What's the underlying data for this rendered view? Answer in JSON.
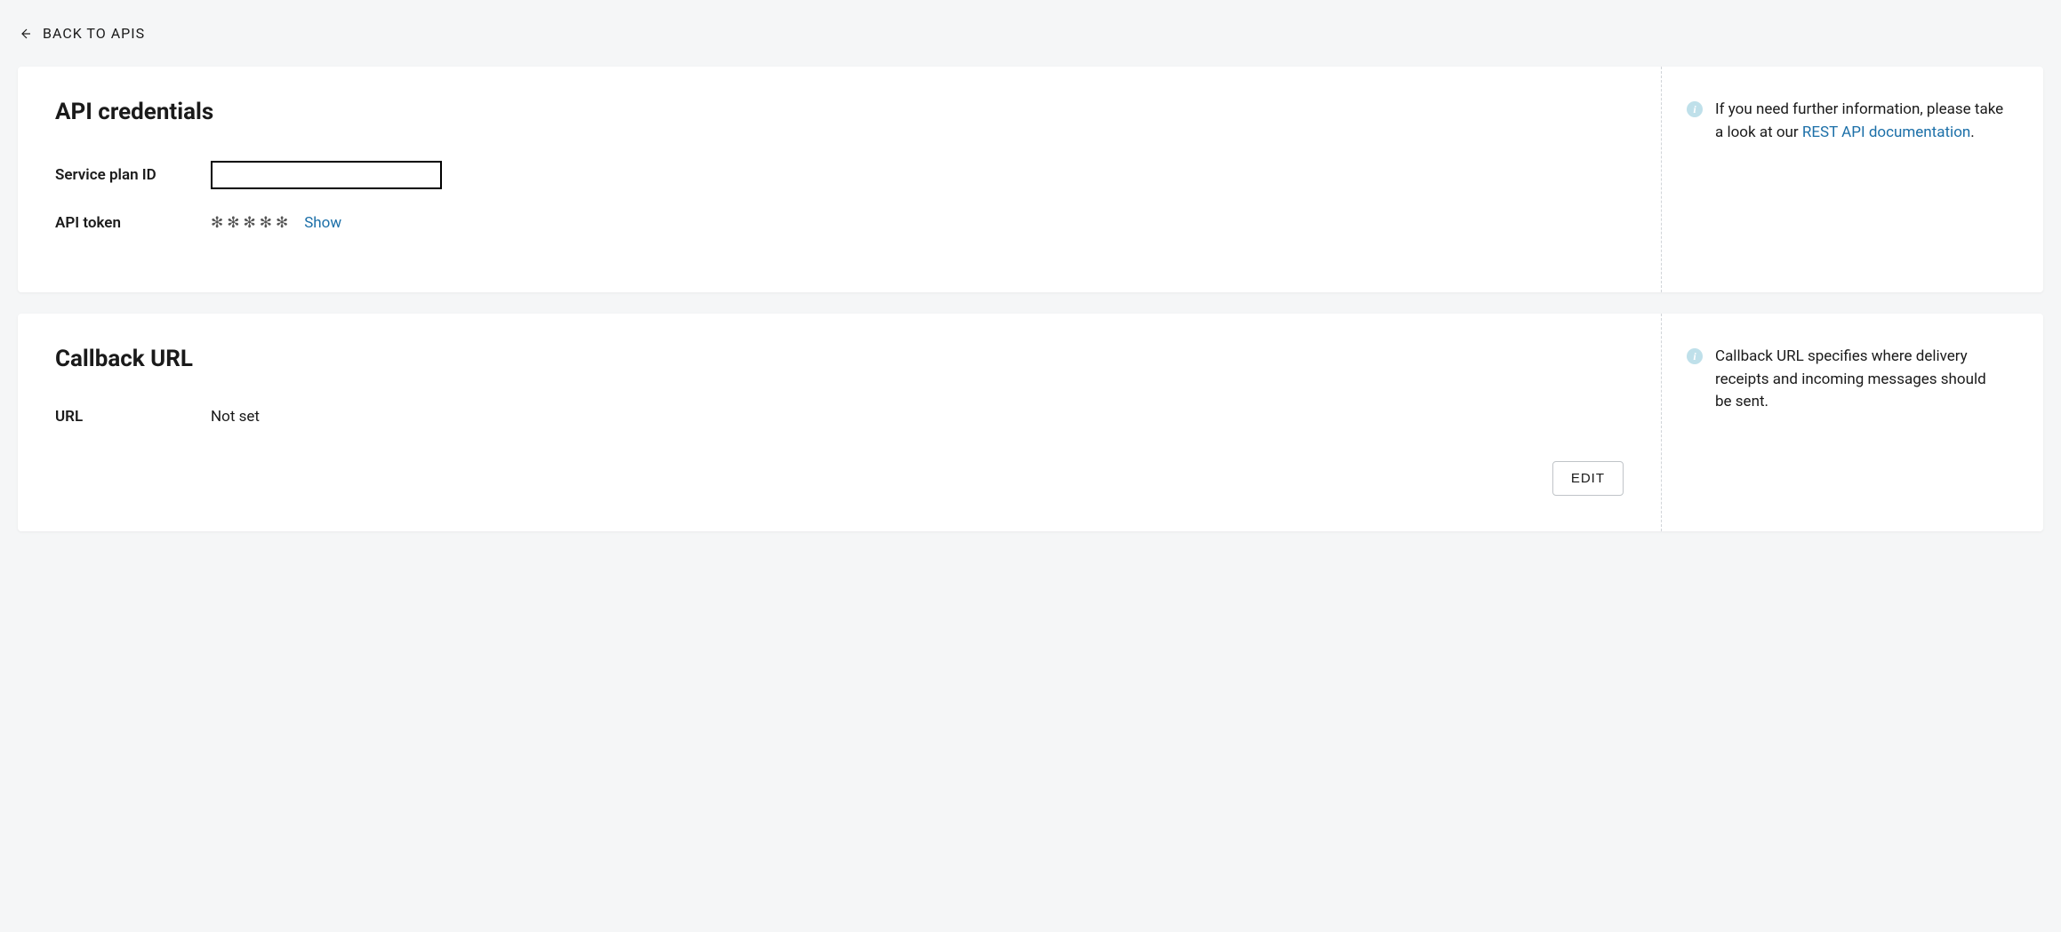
{
  "back_link": {
    "label": "BACK TO APIS"
  },
  "sections": {
    "credentials": {
      "title": "API credentials",
      "service_plan_label": "Service plan ID",
      "service_plan_value": "",
      "api_token_label": "API token",
      "api_token_masked": "✻✻✻✻✻",
      "show_label": "Show",
      "info_text_prefix": "If you need further information, please take a look at our ",
      "info_link_label": "REST API documentation",
      "info_text_suffix": "."
    },
    "callback": {
      "title": "Callback URL",
      "url_label": "URL",
      "url_value": "Not set",
      "edit_label": "EDIT",
      "info_text": "Callback URL specifies where delivery receipts and incoming messages should be sent."
    }
  }
}
